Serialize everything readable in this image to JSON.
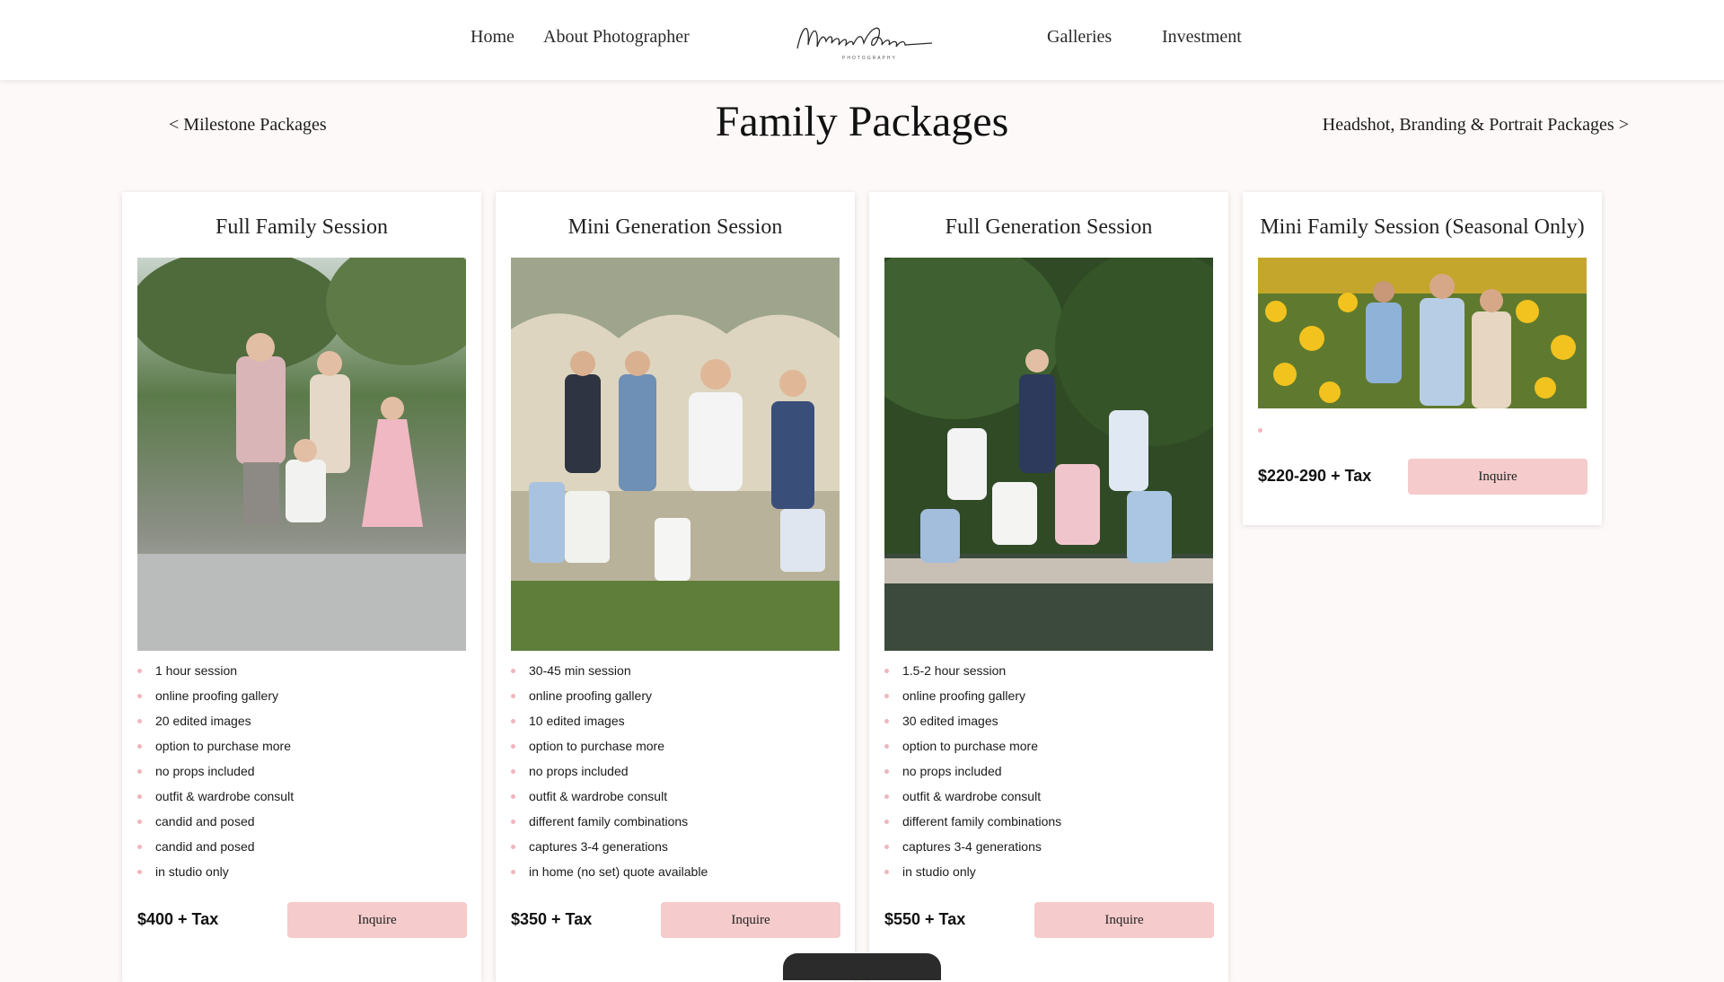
{
  "nav": {
    "home": "Home",
    "about": "About Photographer",
    "galleries": "Galleries",
    "investment": "Investment",
    "logo_text": "Magnolia Coasts",
    "logo_sub": "PHOTOGRAPHY"
  },
  "subnav": {
    "prev": "<  Milestone Packages",
    "next": "Headshot, Branding & Portrait Packages  >"
  },
  "page": {
    "title": "Family Packages"
  },
  "colors": {
    "accent": "#f5cbcb",
    "bullet": "#f0b6bc",
    "background": "#fdf9f8"
  },
  "cards": [
    {
      "title": "Full Family Session",
      "features": [
        "1 hour session",
        "online proofing gallery",
        "20 edited images",
        "option to purchase more",
        "no props included",
        "outfit & wardrobe consult",
        "candid and posed",
        "candid and posed",
        "in studio only"
      ],
      "price": "$400 + Tax",
      "button": "Inquire"
    },
    {
      "title": "Mini Generation Session",
      "features": [
        "30-45 min session",
        "online proofing gallery",
        "10 edited images",
        "option to purchase more",
        "no props included",
        "outfit & wardrobe consult",
        "different family combinations",
        "captures 3-4 generations",
        "in home (no set) quote available"
      ],
      "price": "$350 + Tax",
      "button": "Inquire"
    },
    {
      "title": "Full Generation Session",
      "features": [
        "1.5-2 hour session",
        "online proofing gallery",
        "30 edited images",
        "option to purchase more",
        "no props included",
        "outfit & wardrobe consult",
        "different family combinations",
        "captures 3-4 generations",
        "in studio only"
      ],
      "price": "$550 + Tax",
      "button": "Inquire"
    },
    {
      "title": "Mini Family Session (Seasonal Only)",
      "features": [
        ""
      ],
      "price": "$220-290 + Tax",
      "button": "Inquire"
    }
  ]
}
